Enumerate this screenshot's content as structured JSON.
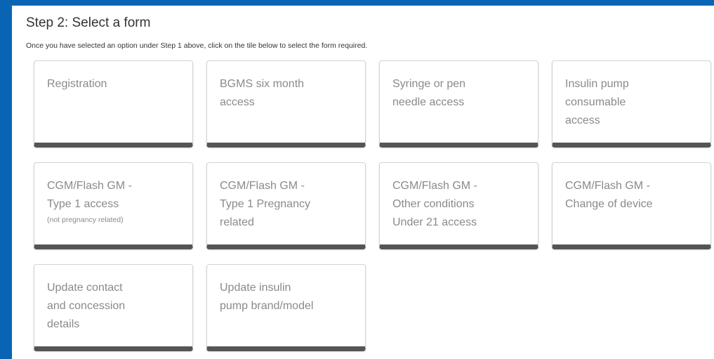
{
  "step": {
    "title": "Step 2: Select a form",
    "description": "Once you have selected an option under Step 1 above, click on the tile below to select the form required."
  },
  "tiles": [
    {
      "label": "Registration",
      "note": ""
    },
    {
      "label": "BGMS six month\naccess",
      "note": ""
    },
    {
      "label": "Syringe or pen\nneedle access",
      "note": ""
    },
    {
      "label": "Insulin pump\nconsumable\naccess",
      "note": ""
    },
    {
      "label": "CGM/Flash GM -\nType 1 access",
      "note": "(not pregnancy related)"
    },
    {
      "label": "CGM/Flash GM -\nType 1 Pregnancy\nrelated",
      "note": ""
    },
    {
      "label": "CGM/Flash GM -\nOther conditions\nUnder 21 access",
      "note": ""
    },
    {
      "label": "CGM/Flash GM -\nChange of device",
      "note": ""
    },
    {
      "label": "Update contact\nand concession\ndetails",
      "note": ""
    },
    {
      "label": "Update insulin\npump brand/model",
      "note": ""
    }
  ],
  "colors": {
    "frame": "#0a64b4",
    "tile_bottom_bar": "#555555",
    "tile_text": "#8a8a8a"
  }
}
